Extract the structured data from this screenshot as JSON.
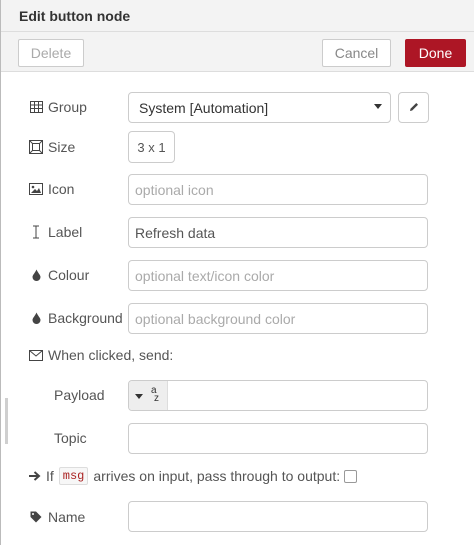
{
  "header": {
    "title": "Edit button node"
  },
  "toolbar": {
    "delete_label": "Delete",
    "cancel_label": "Cancel",
    "done_label": "Done"
  },
  "form": {
    "group": {
      "label": "Group",
      "value": "System [Automation]"
    },
    "size": {
      "label": "Size",
      "value": "3 x 1"
    },
    "icon": {
      "label": "Icon",
      "placeholder": "optional icon"
    },
    "label": {
      "label": "Label",
      "value": "Refresh data"
    },
    "colour": {
      "label": "Colour",
      "placeholder": "optional text/icon color"
    },
    "background": {
      "label": "Background",
      "placeholder": "optional background color"
    },
    "when_clicked": {
      "label": "When clicked, send:"
    },
    "payload": {
      "label": "Payload",
      "type_icon_top": "a",
      "type_icon_bottom": "z",
      "value": ""
    },
    "topic": {
      "label": "Topic",
      "value": ""
    },
    "passthru": {
      "prefix": "If",
      "code": "msg",
      "suffix": "arrives on input, pass through to output:",
      "checked": false
    },
    "name": {
      "label": "Name",
      "value": ""
    }
  },
  "colors": {
    "done_button": "#ad1625",
    "header_bg": "#f3f3f3",
    "code_text": "#aa2222"
  },
  "icons": [
    "table-icon",
    "size-icon",
    "image-icon",
    "text-cursor-icon",
    "tint-icon",
    "tint-icon",
    "envelope-icon",
    "arrow-right-icon",
    "tag-icon",
    "pencil-icon"
  ]
}
